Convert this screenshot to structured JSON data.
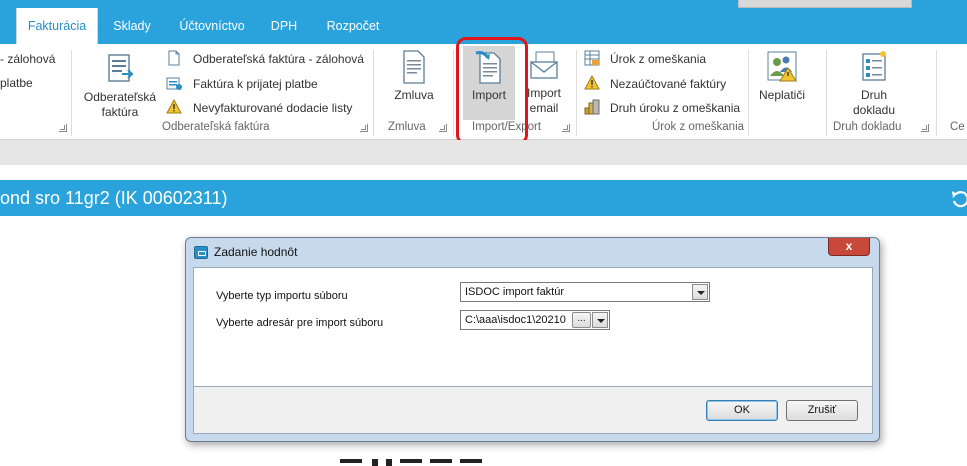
{
  "tabs": [
    {
      "label": "Fakturácia",
      "active": true
    },
    {
      "label": "Sklady"
    },
    {
      "label": "Účtovníctvo"
    },
    {
      "label": "DPH"
    },
    {
      "label": "Rozpočet"
    }
  ],
  "ribbon": {
    "left_partial": {
      "item1": "- zálohová",
      "item2": "platbe"
    },
    "odberatelska": {
      "big_button": {
        "line1": "Odberateľská",
        "line2": "faktúra"
      },
      "items": [
        "Odberateľská faktúra - zálohová",
        "Faktúra k prijatej platbe",
        "Nevyfakturované dodacie listy"
      ],
      "group_label": "Odberateľská faktúra"
    },
    "zmluva": {
      "button": "Zmluva",
      "group_label": "Zmluva"
    },
    "import_export": {
      "import_button": "Import",
      "import_email": {
        "line1": "Import",
        "line2": "email"
      },
      "group_label": "Import/Export"
    },
    "urok": {
      "items": [
        "Úrok z omeškania",
        "Nezaúčtované faktúry",
        "Druh úroku z omeškania"
      ],
      "group_label": "Úrok z omeškania"
    },
    "neplatici": {
      "button": "Neplatiči"
    },
    "druh_dokladu": {
      "button": {
        "line1": "Druh",
        "line2": "dokladu"
      },
      "group_label": "Druh dokladu"
    },
    "right_partial": "Ce"
  },
  "company_title": "ond sro 11gr2 (IK 00602311)",
  "dialog": {
    "title": "Zadanie hodnôt",
    "close_glyph": "x",
    "field1": {
      "label": "Vyberte typ importu súboru",
      "value": "ISDOC import faktúr"
    },
    "field2": {
      "label": "Vyberte adresár pre import súboru",
      "value": "C:\\aaa\\isdoc1\\20210",
      "browse": "..."
    },
    "ok": "OK",
    "cancel": "Zrušiť"
  },
  "colors": {
    "accent": "#2aa3dc",
    "highlight_ring": "#e0161b"
  }
}
